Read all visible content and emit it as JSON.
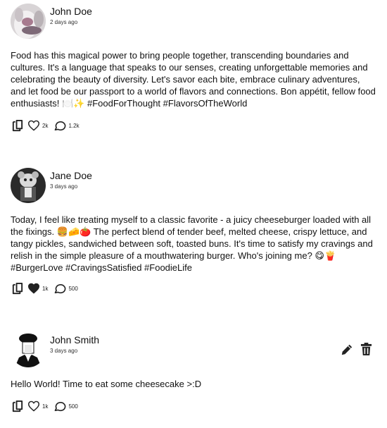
{
  "posts": [
    {
      "author": "John Doe",
      "time": "2 days ago",
      "text": "Food has this magical power to bring people together, transcending boundaries and cultures. It's a language that speaks to our senses, creating unforgettable memories and celebrating the beauty of diversity. Let's savor each bite, embrace culinary adventures, and let food be our passport to a world of flavors and connections. Bon appétit, fellow food enthusiasts! 🍽️✨ #FoodForThought #FlavorsOfTheWorld",
      "likes": "2k",
      "comments": "1.2k",
      "liked": false
    },
    {
      "author": "Jane Doe",
      "time": "3 days ago",
      "text": "Today, I feel like treating myself to a classic favorite - a juicy cheeseburger loaded with all the fixings. 🍔🧀🍅 The perfect blend of tender beef, melted cheese, crispy lettuce, and tangy pickles, sandwiched between soft, toasted buns. It's time to satisfy my cravings and relish in the simple pleasure of a mouthwatering burger. Who's joining me? 😋🍟 #BurgerLove #CravingsSatisfied #FoodieLife",
      "likes": "1k",
      "comments": "500",
      "liked": true
    },
    {
      "author": "John Smith",
      "time": "3 days ago",
      "text": "Hello World! Time to eat some cheesecake >:D",
      "likes": "1k",
      "comments": "500",
      "liked": false,
      "owner_actions": [
        "pencil-icon",
        "trash-icon"
      ]
    }
  ]
}
